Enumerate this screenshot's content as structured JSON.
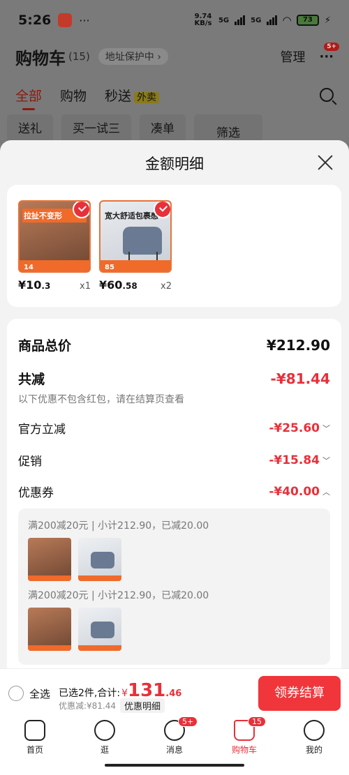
{
  "status_bar": {
    "time": "5:26",
    "dots": "···",
    "speed": "9.74 KB/s",
    "net1": "5G",
    "net2": "5G",
    "battery": "73"
  },
  "header": {
    "title": "购物车",
    "count": "(15)",
    "address": "地址保护中",
    "manage": "管理",
    "more_badge": "5+"
  },
  "tabs": [
    {
      "label": "全部"
    },
    {
      "label": "购物"
    },
    {
      "label": "秒送"
    }
  ],
  "tab_badge": "外卖",
  "chips": [
    "送礼",
    "买一试三",
    "凑单",
    "筛选"
  ],
  "sheet": {
    "title": "金额明细",
    "products": [
      {
        "price_int": "¥10",
        "price_dec": ".3",
        "qty": "x1",
        "tag": "拉扯不变形",
        "num": "14"
      },
      {
        "price_int": "¥60",
        "price_dec": ".58",
        "qty": "x2",
        "tag": "宽大舒适包裹感",
        "num": "85"
      }
    ],
    "total_label": "商品总价",
    "total_value": "¥212.90",
    "reduce_label": "共减",
    "reduce_value": "-¥81.44",
    "note": "以下优惠不包含红包，请在结算页查看",
    "official_label": "官方立减",
    "official_value": "-¥25.60",
    "promo_label": "促销",
    "promo_value": "-¥15.84",
    "coupon_label": "优惠券",
    "coupon_value": "-¥40.00",
    "coupon_lines": [
      "满200减20元 | 小计212.90，已减20.00",
      "满200减20元 | 小计212.90，已减20.00"
    ]
  },
  "bottom": {
    "select_all": "全选",
    "selected": "已选2件,合计:",
    "currency": "¥",
    "total_int": "131",
    "total_dec": ".46",
    "discount": "优惠减:¥81.44",
    "detail": "优惠明细",
    "checkout": "领券结算"
  },
  "nav": [
    {
      "label": "首页"
    },
    {
      "label": "逛"
    },
    {
      "label": "消息",
      "badge": "5+"
    },
    {
      "label": "购物车",
      "badge": "15"
    },
    {
      "label": "我的"
    }
  ],
  "colors": {
    "accent": "#e8303a",
    "overlay": "#7f7f7f"
  }
}
